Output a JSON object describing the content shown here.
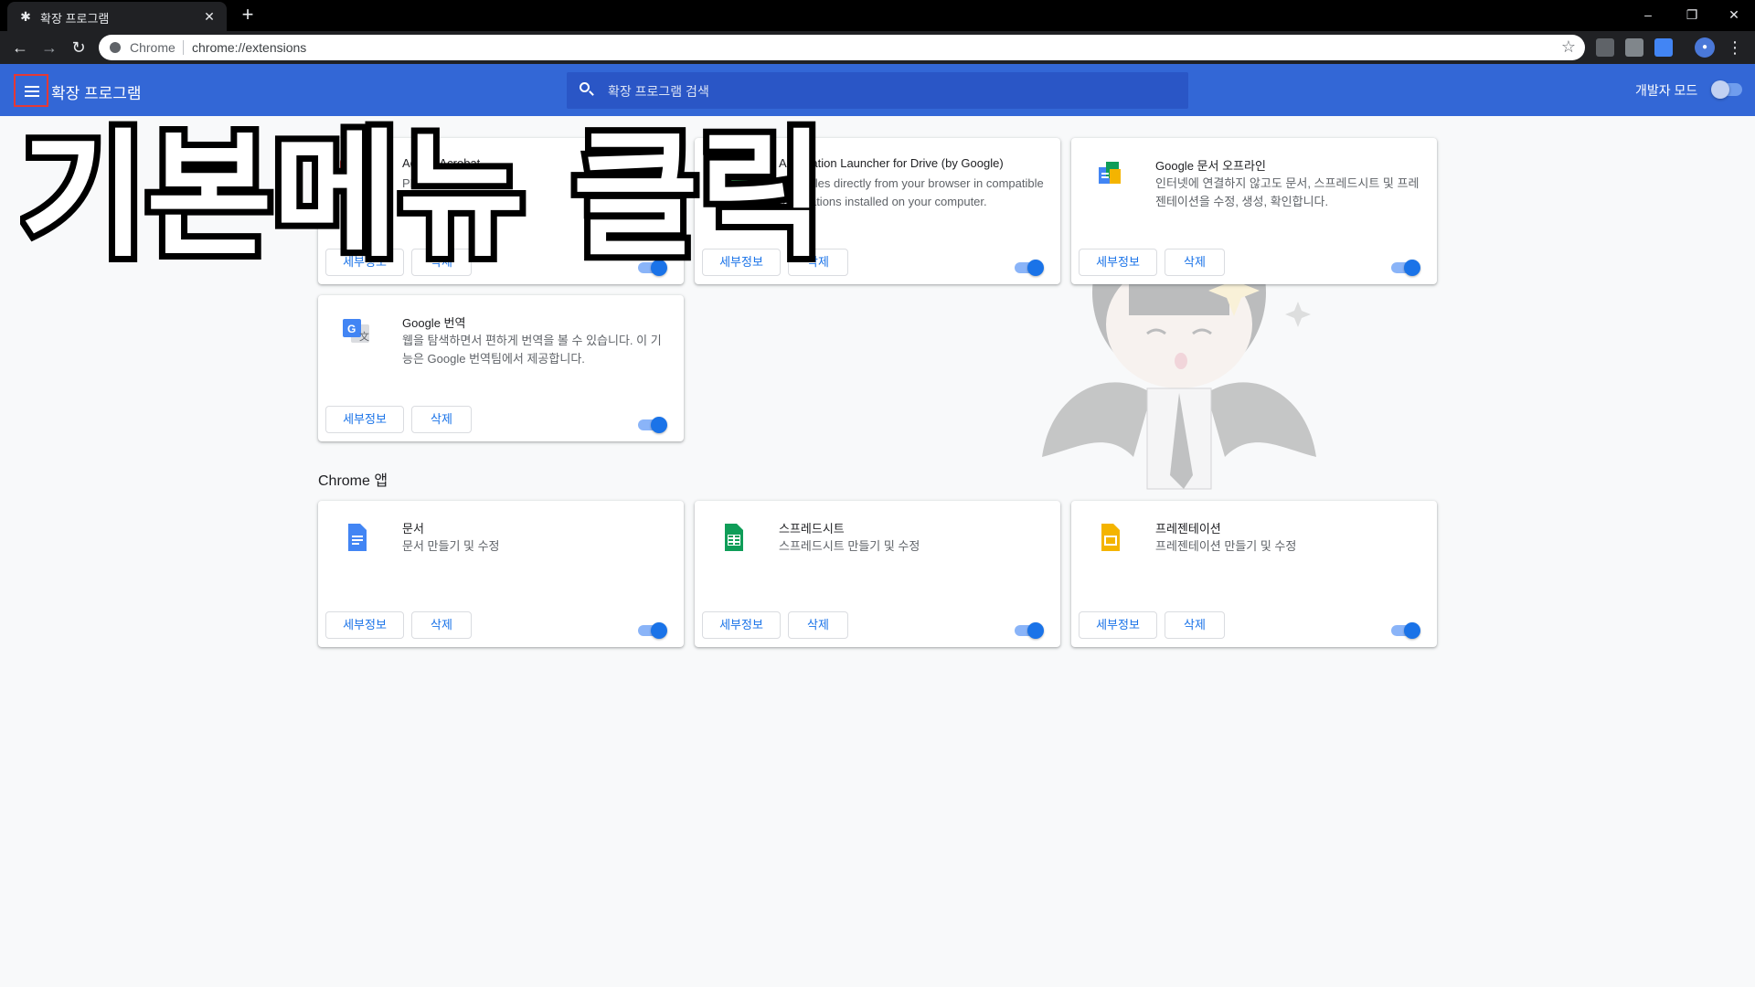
{
  "window": {
    "tab_title": "확장 프로그램",
    "new_tab": "+",
    "minimize": "–",
    "restore": "❐",
    "close": "✕"
  },
  "toolbar": {
    "back": "←",
    "forward": "→",
    "reload": "↻",
    "site_chip": "Chrome",
    "url": "chrome://extensions",
    "bookmark_star": "☆",
    "menu": "⋮"
  },
  "header": {
    "title": "확장 프로그램",
    "search_placeholder": "확장 프로그램 검색",
    "dev_mode_label": "개발자 모드",
    "dev_mode_on": false
  },
  "extensions": [
    {
      "name": "Adobe Acrobat",
      "description": "PDF",
      "details": "세부정보",
      "remove": "삭제",
      "enabled": true,
      "icon": "acrobat-icon"
    },
    {
      "name": "Application Launcher for Drive (by Google)",
      "description": "Save files directly from your browser in compatible applications installed on your computer.",
      "details": "세부정보",
      "remove": "삭제",
      "enabled": true,
      "icon": "drive-launcher-icon"
    },
    {
      "name": "Google 문서 오프라인",
      "description": "인터넷에 연결하지 않고도 문서, 스프레드시트 및 프레젠테이션을 수정, 생성, 확인합니다.",
      "details": "세부정보",
      "remove": "삭제",
      "enabled": true,
      "icon": "docs-offline-icon"
    },
    {
      "name": "Google 번역",
      "description": "웹을 탐색하면서 편하게 번역을 볼 수 있습니다. 이 기능은 Google 번역팀에서 제공합니다.",
      "details": "세부정보",
      "remove": "삭제",
      "enabled": true,
      "icon": "translate-icon"
    }
  ],
  "apps_section": {
    "title": "Chrome 앱",
    "items": [
      {
        "name": "문서",
        "description": "문서 만들기 및 수정",
        "details": "세부정보",
        "remove": "삭제",
        "enabled": true,
        "icon": "docs-icon",
        "color": "#4285f4"
      },
      {
        "name": "스프레드시트",
        "description": "스프레드시트 만들기 및 수정",
        "details": "세부정보",
        "remove": "삭제",
        "enabled": true,
        "icon": "sheets-icon",
        "color": "#0f9d58"
      },
      {
        "name": "프레젠테이션",
        "description": "프레젠테이션 만들기 및 수정",
        "details": "세부정보",
        "remove": "삭제",
        "enabled": true,
        "icon": "slides-icon",
        "color": "#f4b400"
      }
    ]
  },
  "overlay_caption": "기본메뉴 클릭",
  "colors": {
    "header_blue": "#3367d6",
    "highlight_red": "#e53935",
    "toggle_blue": "#1a73e8"
  }
}
